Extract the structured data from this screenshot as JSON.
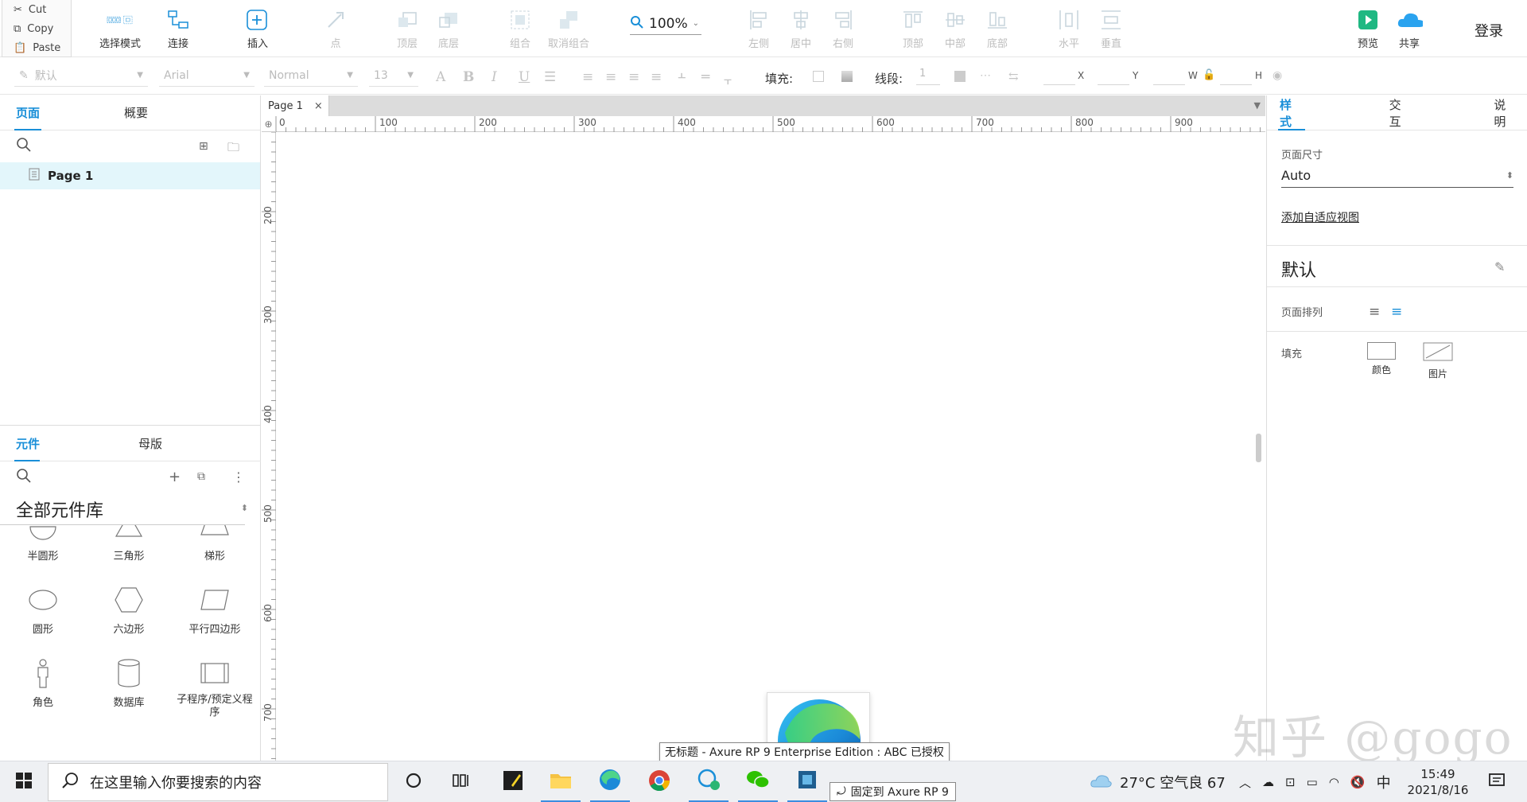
{
  "clipboard": {
    "cut": "Cut",
    "copy": "Copy",
    "paste": "Paste"
  },
  "toolbar": {
    "select_mode": "选择模式",
    "connect": "连接",
    "insert": "插入",
    "point": "点",
    "top_layer": "顶层",
    "bottom_layer": "底层",
    "group": "组合",
    "ungroup": "取消组合",
    "zoom": "100%",
    "align_left": "左侧",
    "align_center": "居中",
    "align_right": "右侧",
    "align_top": "顶部",
    "align_middle": "中部",
    "align_bottom": "底部",
    "dist_h": "水平",
    "dist_v": "垂直",
    "preview": "预览",
    "share": "共享",
    "login": "登录"
  },
  "format": {
    "style": "默认",
    "font": "Arial",
    "weight": "Normal",
    "size": "13",
    "fill_label": "填充:",
    "stroke_label": "线段:",
    "stroke_value": "1",
    "x": "X",
    "y": "Y",
    "w": "W",
    "h": "H"
  },
  "left_panel": {
    "tab_pages": "页面",
    "tab_outline": "概要",
    "page_item": "Page 1",
    "tab_widgets": "元件",
    "tab_masters": "母版",
    "library_title": "全部元件库",
    "shapes": [
      "半圆形",
      "三角形",
      "梯形",
      "圆形",
      "六边形",
      "平行四边形",
      "角色",
      "数据库",
      "子程序/预定义程序"
    ]
  },
  "canvas": {
    "doc_tab": "Page 1",
    "ruler_h": [
      "0",
      "100",
      "200",
      "300",
      "400",
      "500",
      "600",
      "700",
      "800",
      "900"
    ],
    "ruler_v": [
      "200",
      "300",
      "400",
      "500",
      "600",
      "700"
    ]
  },
  "right_panel": {
    "tab_style": "样式",
    "tab_interact": "交互",
    "tab_notes": "说明",
    "page_size_label": "页面尺寸",
    "page_size_value": "Auto",
    "add_adaptive": "添加自适应视图",
    "default_title": "默认",
    "page_align_label": "页面排列",
    "fill_label": "填充",
    "fill_color": "颜色",
    "fill_image": "图片"
  },
  "taskbar": {
    "search_placeholder": "在这里输入你要搜索的内容",
    "weather": "27°C 空气良 67",
    "ime": "中",
    "time": "15:49",
    "date": "2021/8/16"
  },
  "tooltip": "无标题 - Axure RP 9 Enterprise Edition : ABC 已授权",
  "pin_label": "固定到 Axure RP 9",
  "watermark": "知乎 @gogo",
  "colors": {
    "accent": "#1a8fd8",
    "preview_green": "#1fb882",
    "share_blue": "#2aa3ef"
  }
}
